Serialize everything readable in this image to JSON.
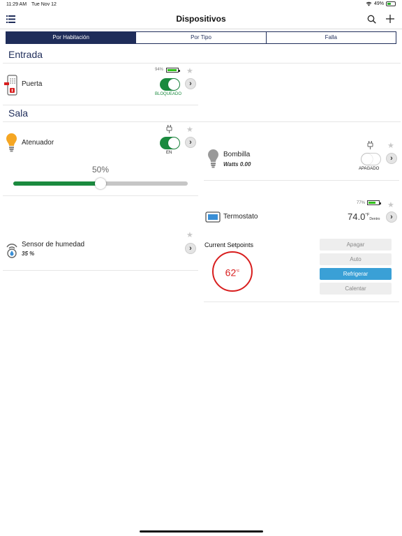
{
  "status_bar": {
    "time": "11:29 AM",
    "date": "Tue Nov 12",
    "battery": "49%"
  },
  "nav": {
    "title": "Dispositivos"
  },
  "tabs": [
    {
      "label": "Por Habitación",
      "active": true
    },
    {
      "label": "Por Tipo",
      "active": false
    },
    {
      "label": "Falla",
      "active": false
    }
  ],
  "sections": {
    "entrada": {
      "title": "Entrada",
      "door": {
        "name": "Puerta",
        "battery": "94%",
        "battery_level": 0.94,
        "state": "BLOQUEADO",
        "on": true
      }
    },
    "sala": {
      "title": "Sala",
      "dimmer": {
        "name": "Atenuador",
        "state": "EN",
        "on": true,
        "level_label": "50%",
        "level": 0.5
      },
      "bulb": {
        "name": "Bombilla",
        "watts": "Watts 0.00",
        "state": "APAGADO",
        "on": false
      },
      "humidity": {
        "name": "Sensor de humedad",
        "value": "35 %"
      },
      "thermostat": {
        "name": "Termostato",
        "battery": "77%",
        "battery_level": 0.77,
        "temp": "74.0",
        "temp_unit": "°F",
        "temp_location": "Dentro",
        "setpoints_label": "Current Setpoints",
        "setpoint": "62",
        "setpoint_unit": "°F",
        "modes": [
          {
            "label": "Apagar",
            "active": false
          },
          {
            "label": "Auto",
            "active": false
          },
          {
            "label": "Refrigerar",
            "active": true
          },
          {
            "label": "Calentar",
            "active": false
          }
        ]
      }
    }
  },
  "colors": {
    "accent": "#1f2d5a",
    "on": "#1a8a3e",
    "active_mode": "#3aa0d6",
    "setpoint_ring": "#d81e1e"
  }
}
